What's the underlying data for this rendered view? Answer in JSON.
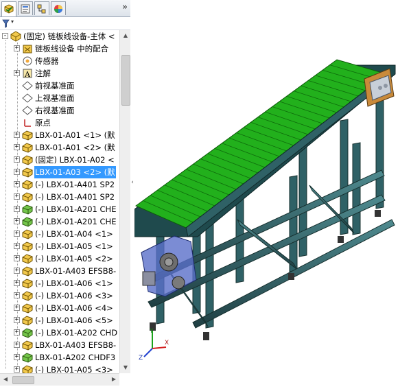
{
  "panel_tabs": [
    "feature-manager",
    "property-manager",
    "configuration-manager",
    "display-manager"
  ],
  "overflow_glyph": "»",
  "filter": {
    "icon": "funnel-icon",
    "dropdown": "▾"
  },
  "tree": {
    "root": "(固定) 链板线设备-主体 <",
    "items": [
      {
        "label": "链板线设备  中的配合",
        "icon": "mates-icon"
      },
      {
        "label": "传感器",
        "icon": "sensor-icon"
      },
      {
        "label": "注解",
        "icon": "annotation-icon"
      },
      {
        "label": "前视基准面",
        "icon": "plane-icon"
      },
      {
        "label": "上视基准面",
        "icon": "plane-icon"
      },
      {
        "label": "右视基准面",
        "icon": "plane-icon"
      },
      {
        "label": "原点",
        "icon": "origin-icon"
      },
      {
        "label": "LBX-01-A01 <1> (默",
        "icon": "part-icon"
      },
      {
        "label": "LBX-01-A01 <2> (默",
        "icon": "part-icon"
      },
      {
        "label": "(固定) LBX-01-A02 <",
        "icon": "part-icon"
      },
      {
        "label": "LBX-01-A03 <2> (默",
        "icon": "part-icon",
        "selected": true
      },
      {
        "label": "(-) LBX-01-A401 SP2",
        "icon": "part-icon"
      },
      {
        "label": "(-) LBX-01-A401 SP2",
        "icon": "part-icon"
      },
      {
        "label": "(-) LBX-01-A201 CHE",
        "icon": "part-green-icon"
      },
      {
        "label": "(-) LBX-01-A201 CHE",
        "icon": "part-green-icon"
      },
      {
        "label": "(-) LBX-01-A04 <1>",
        "icon": "part-icon"
      },
      {
        "label": "(-) LBX-01-A05 <1>",
        "icon": "part-icon"
      },
      {
        "label": "(-) LBX-01-A05 <2>",
        "icon": "part-icon"
      },
      {
        "label": "LBX-01-A403 EFSB8-",
        "icon": "part-icon"
      },
      {
        "label": "(-) LBX-01-A06 <1>",
        "icon": "part-icon"
      },
      {
        "label": "(-) LBX-01-A06 <3>",
        "icon": "part-icon"
      },
      {
        "label": "(-) LBX-01-A06 <4>",
        "icon": "part-icon"
      },
      {
        "label": "(-) LBX-01-A06 <5>",
        "icon": "part-icon"
      },
      {
        "label": "(-) LBX-01-A202 CHD",
        "icon": "part-green-icon"
      },
      {
        "label": "LBX-01-A403 EFSB8-",
        "icon": "part-icon"
      },
      {
        "label": "LBX-01-A202 CHDF3",
        "icon": "part-green-icon"
      },
      {
        "label": "(-) LBX-01-A05 <3>",
        "icon": "part-icon"
      }
    ]
  },
  "triad": {
    "x": "X",
    "y": "Y",
    "z": "Z"
  },
  "colors": {
    "selection": "#3399ff",
    "chain_green": "#22b01c",
    "frame_teal": "#2f6166",
    "motor_blue": "#5a6fc9",
    "control_orange": "#c98a3a"
  }
}
